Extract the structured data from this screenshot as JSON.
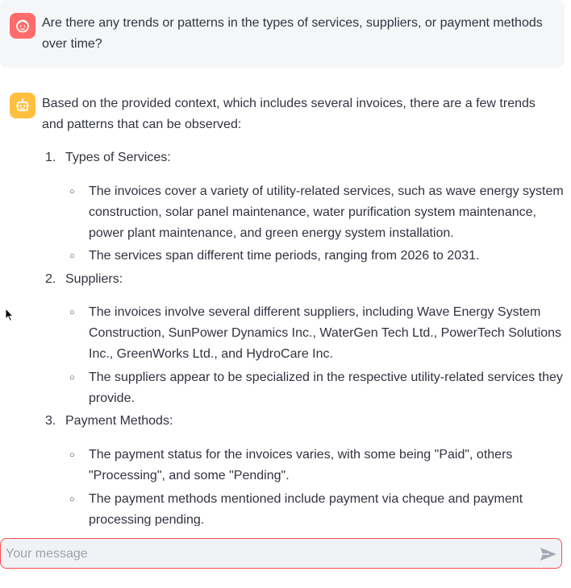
{
  "user_message": {
    "avatar_icon": "user-face-icon",
    "text": "Are there any trends or patterns in the types of services, suppliers, or payment methods over time?"
  },
  "assistant_message": {
    "avatar_icon": "robot-icon",
    "intro": "Based on the provided context, which includes several invoices, there are a few trends and patterns that can be observed:",
    "sections": [
      {
        "number": "1.",
        "title": "Types of Services:",
        "bullets": [
          "The invoices cover a variety of utility-related services, such as wave energy system construction, solar panel maintenance, water purification system maintenance, power plant maintenance, and green energy system installation.",
          "The services span different time periods, ranging from 2026 to 2031."
        ]
      },
      {
        "number": "2.",
        "title": "Suppliers:",
        "bullets": [
          "The invoices involve several different suppliers, including Wave Energy System Construction, SunPower Dynamics Inc., WaterGen Tech Ltd., PowerTech Solutions Inc., GreenWorks Ltd., and HydroCare Inc.",
          "The suppliers appear to be specialized in the respective utility-related services they provide."
        ]
      },
      {
        "number": "3.",
        "title": "Payment Methods:",
        "bullets": [
          "The payment status for the invoices varies, with some being \"Paid\", others \"Processing\", and some \"Pending\".",
          "The payment methods mentioned include payment via cheque and payment processing pending."
        ]
      }
    ]
  },
  "chat_input": {
    "placeholder": "Your message",
    "value": "",
    "send_icon": "send-icon"
  },
  "colors": {
    "user_avatar": "#ff6b6b",
    "bot_avatar": "#ffbf3f",
    "input_border": "#ff4b4b",
    "text": "#31333f"
  }
}
